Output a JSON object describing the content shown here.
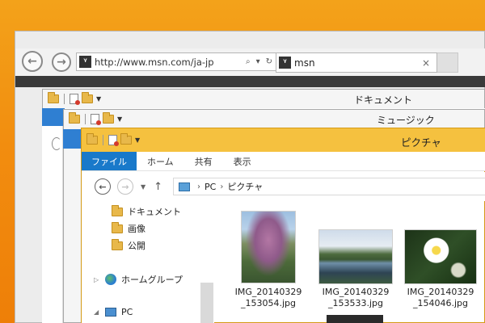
{
  "ie": {
    "address_url": "http://www.msn.com/ja-jp",
    "tab_title": "msn",
    "site_icon": "msn-logo-icon",
    "close_icon": "×"
  },
  "doc_window": {
    "title": "ドキュメント"
  },
  "music_window": {
    "title": "ミュージック"
  },
  "pictures_window": {
    "title": "ピクチャ",
    "ribbon_tabs": [
      "ファイル",
      "ホーム",
      "共有",
      "表示"
    ],
    "breadcrumb": [
      "PC",
      "ピクチャ"
    ],
    "nav_items": [
      "ドキュメント",
      "画像",
      "公開",
      "ホームグループ",
      "PC"
    ],
    "files": [
      {
        "name_line1": "IMG_20140329",
        "name_line2": "_153054.jpg"
      },
      {
        "name_line1": "IMG_20140329",
        "name_line2": "_153533.jpg"
      },
      {
        "name_line1": "IMG_20140329",
        "name_line2": "_154046.jpg"
      }
    ]
  },
  "colors": {
    "desktop": "#f28d0f",
    "explorer_title": "#f5c13f",
    "file_tab": "#1979ca"
  }
}
